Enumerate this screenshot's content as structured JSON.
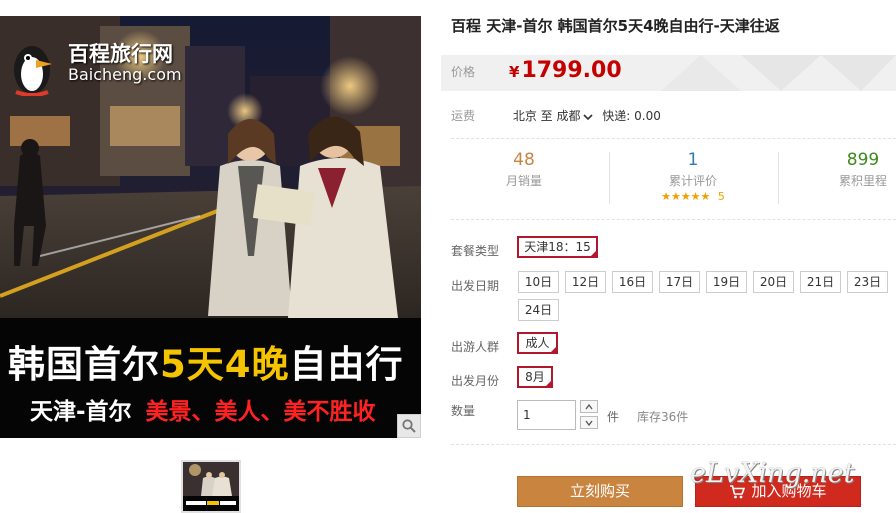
{
  "product": {
    "image_logo_cn": "百程旅行网",
    "image_logo_en": "Baicheng.com",
    "image_headline_parts": [
      "韩国首尔",
      "5天4晚",
      "自由行"
    ],
    "image_sub_route": "天津-首尔",
    "image_sub_slogan": "美景、美人、美不胜收",
    "title": "百程 天津-首尔 韩国首尔5天4晚自由行-天津往返"
  },
  "price": {
    "label": "价格",
    "currency": "¥",
    "value": "1799.00"
  },
  "shipping": {
    "label": "运费",
    "route": "北京 至 成都",
    "method": "快递: 0.00"
  },
  "stats": [
    {
      "value": "48",
      "label": "月销量",
      "color": "#c98540"
    },
    {
      "value": "1",
      "label": "累计评价",
      "color": "#2c7cb8",
      "stars": "★★★★★",
      "score": "5"
    },
    {
      "value": "899",
      "label": "累积里程",
      "color": "#3c8a1e"
    }
  ],
  "options": {
    "package": {
      "label": "套餐类型",
      "selected": "天津18：15"
    },
    "departure_date": {
      "label": "出发日期",
      "values": [
        "10日",
        "12日",
        "16日",
        "17日",
        "19日",
        "20日",
        "21日",
        "23日",
        "24日"
      ]
    },
    "travelers": {
      "label": "出游人群",
      "selected": "成人"
    },
    "month": {
      "label": "出发月份",
      "selected": "8月"
    }
  },
  "quantity": {
    "label": "数量",
    "value": "1",
    "unit": "件",
    "stock": "库存36件"
  },
  "actions": {
    "buy": "立刻购买",
    "cart": "加入购物车"
  },
  "watermark": "eLvXing.net",
  "colors": {
    "price": "#c40000",
    "selected_border": "#b2172e",
    "buy_button": "#c98540",
    "cart_button": "#d02a1e"
  }
}
